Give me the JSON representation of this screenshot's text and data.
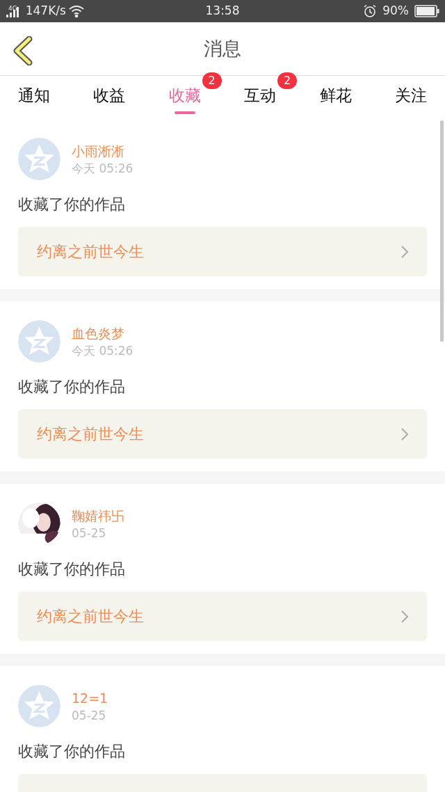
{
  "status_bar": {
    "network": "4G",
    "speed": "147K/s",
    "time": "13:58",
    "battery": "90%"
  },
  "header": {
    "title": "消息"
  },
  "tabs": [
    {
      "label": "通知",
      "selected": false
    },
    {
      "label": "收益",
      "selected": false
    },
    {
      "label": "收藏",
      "selected": true,
      "badge": "2"
    },
    {
      "label": "互动",
      "selected": false,
      "badge": "2"
    },
    {
      "label": "鲜花",
      "selected": false
    },
    {
      "label": "关注",
      "selected": false
    }
  ],
  "messages": [
    {
      "kind": "default",
      "name": "小雨淅淅",
      "time": "今天 05:26",
      "text": "收藏了你的作品",
      "work": "约离之前世今生"
    },
    {
      "kind": "default",
      "name": "血色炎梦",
      "time": "今天 05:26",
      "text": "收藏了你的作品",
      "work": "约离之前世今生"
    },
    {
      "kind": "picture",
      "name": "鞠婧祎卐",
      "time": "05-25",
      "text": "收藏了你的作品",
      "work": "约离之前世今生"
    },
    {
      "kind": "default",
      "name": "12=1",
      "time": "05-25",
      "text": "收藏了你的作品"
    }
  ]
}
